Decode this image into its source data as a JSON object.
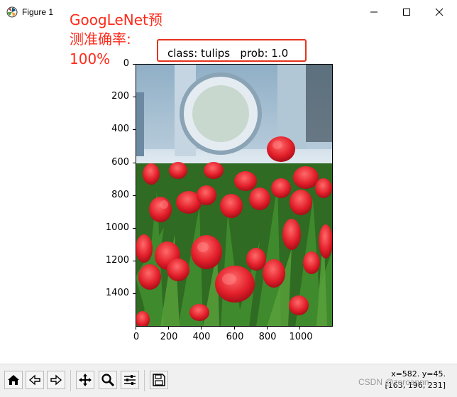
{
  "window": {
    "title": "Figure 1",
    "controls": {
      "minimize": "minimize-icon",
      "maximize": "maximize-icon",
      "close": "close-icon"
    }
  },
  "annotation": {
    "line1": "GoogLeNet预",
    "line2": "测准确率:",
    "line3": "100%",
    "color": "#ff2a1a"
  },
  "plot": {
    "title": "class: tulips   prob: 1.0",
    "highlight_color": "#e8321e",
    "y_ticks": [
      "0",
      "200",
      "400",
      "600",
      "800",
      "1000",
      "1200",
      "1400"
    ],
    "x_ticks": [
      "0",
      "200",
      "400",
      "600",
      "800",
      "1000"
    ],
    "image_subject": "red tulips in greenhouse"
  },
  "toolbar": {
    "buttons": [
      "home-icon",
      "back-icon",
      "forward-icon",
      "pan-icon",
      "zoom-icon",
      "configure-icon",
      "save-icon"
    ]
  },
  "status": {
    "position": "x=582. y=45.",
    "pixel": "[163, 196, 231]"
  },
  "watermark": "CSDN @zeroannn"
}
